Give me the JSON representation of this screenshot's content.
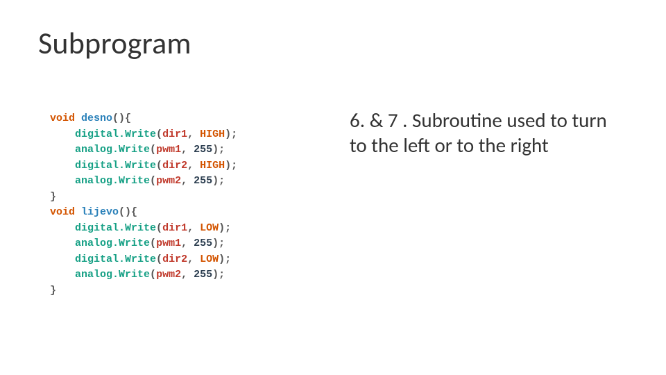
{
  "title": "Subprogram",
  "explanation": "6. & 7 . Subroutine used to turn to the left or to the right",
  "code": {
    "func1": {
      "decl_kw": "void",
      "decl_name": "desno",
      "decl_tail": "(){",
      "l1_call": "digital.Write",
      "l1_open": "(",
      "l1_arg1": "dir1",
      "l1_sep": ", ",
      "l1_arg2": "HIGH",
      "l1_close": ");",
      "l2_call": "analog.Write",
      "l2_open": "(",
      "l2_arg1": "pwm1",
      "l2_sep": ", ",
      "l2_arg2": "255",
      "l2_close": ");",
      "l3_call": "digital.Write",
      "l3_open": "(",
      "l3_arg1": "dir2",
      "l3_sep": ", ",
      "l3_arg2": "HIGH",
      "l3_close": ");",
      "l4_call": "analog.Write",
      "l4_open": "(",
      "l4_arg1": "pwm2",
      "l4_sep": ", ",
      "l4_arg2": "255",
      "l4_close": ");",
      "end": "}"
    },
    "func2": {
      "decl_kw": "void",
      "decl_name": "lijevo",
      "decl_tail": "(){",
      "l1_call": "digital.Write",
      "l1_open": "(",
      "l1_arg1": "dir1",
      "l1_sep": ", ",
      "l1_arg2": "LOW",
      "l1_close": ");",
      "l2_call": "analog.Write",
      "l2_open": "(",
      "l2_arg1": "pwm1",
      "l2_sep": ", ",
      "l2_arg2": "255",
      "l2_close": ");",
      "l3_call": "digital.Write",
      "l3_open": "(",
      "l3_arg1": "dir2",
      "l3_sep": ", ",
      "l3_arg2": "LOW",
      "l3_close": ");",
      "l4_call": "analog.Write",
      "l4_open": "(",
      "l4_arg1": "pwm2",
      "l4_sep": ", ",
      "l4_arg2": "255",
      "l4_close": ");",
      "end": "}"
    }
  }
}
